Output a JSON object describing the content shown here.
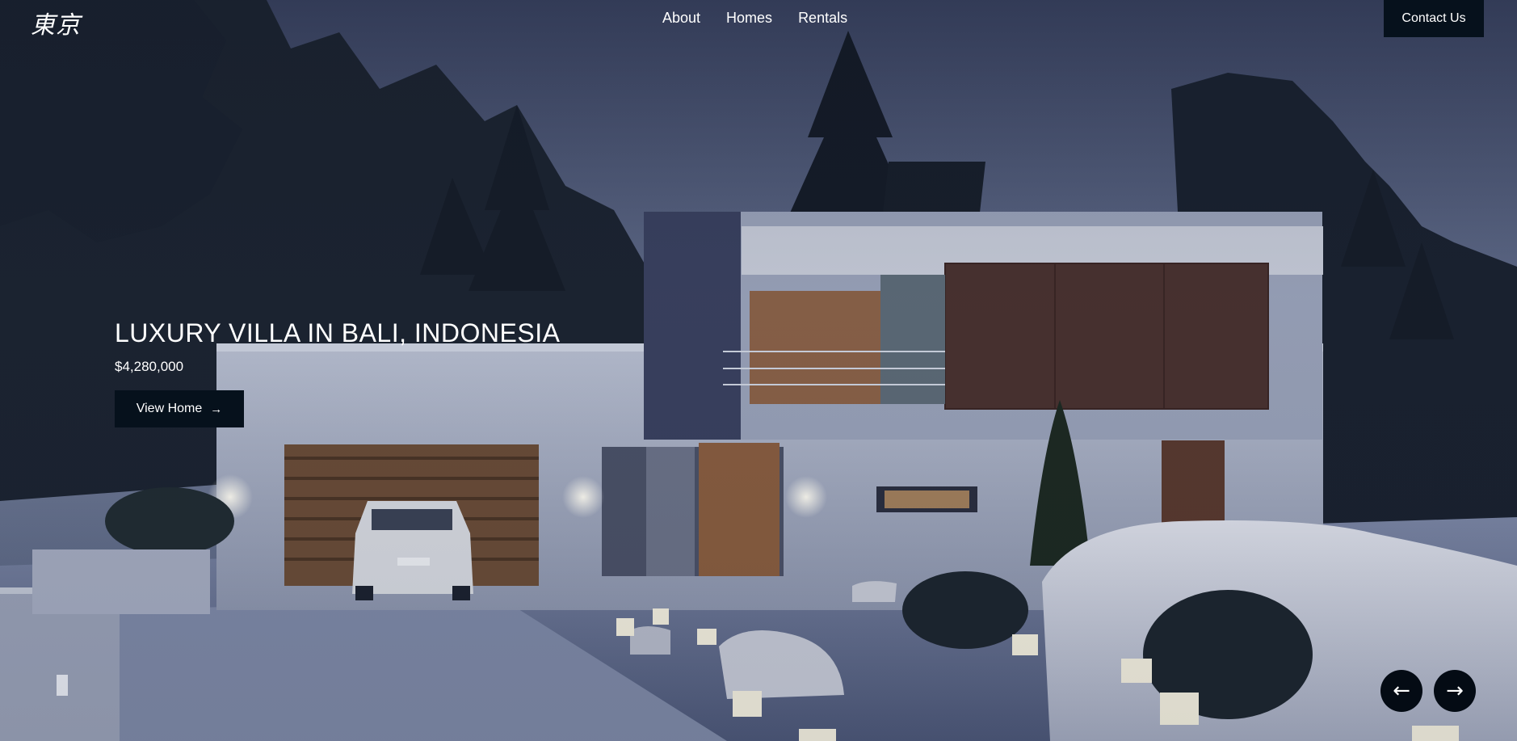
{
  "header": {
    "logo": "東京",
    "nav": [
      {
        "label": "About"
      },
      {
        "label": "Homes"
      },
      {
        "label": "Rentals"
      }
    ],
    "contact_label": "Contact Us"
  },
  "hero": {
    "title": "LUXURY VILLA IN BALI, INDONESIA",
    "price": "$4,280,000",
    "cta_label": "View Home",
    "cta_icon": "arrow-right-icon"
  },
  "slider": {
    "prev_icon": "arrow-left-icon",
    "next_icon": "arrow-right-icon"
  },
  "colors": {
    "button_bg": "#06111c",
    "sky": "#55607e",
    "text": "#ffffff"
  }
}
